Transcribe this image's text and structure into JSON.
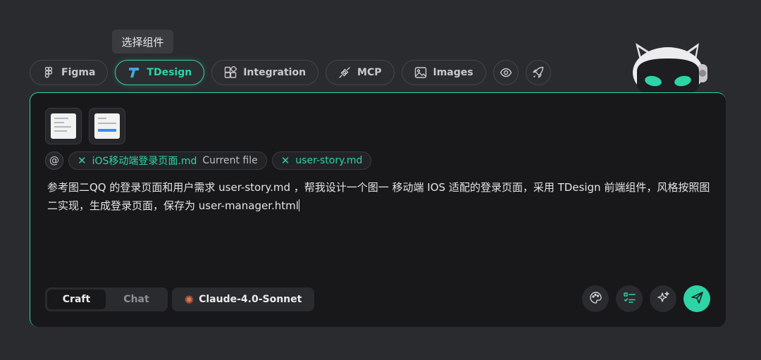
{
  "tooltip": "选择组件",
  "toolbar": {
    "figma": "Figma",
    "tdesign": "TDesign",
    "integration": "Integration",
    "mcp": "MCP",
    "images": "Images"
  },
  "attachments": {
    "at_symbol": "@",
    "files": [
      {
        "name": "iOS移动端登录页面.md",
        "tag": "Current file"
      },
      {
        "name": "user-story.md",
        "tag": ""
      }
    ],
    "remove_glyph": "✕"
  },
  "prompt": {
    "text": "参考图二QQ 的登录页面和用户需求 user-story.md ，帮我设计一个图一 移动端 IOS 适配的登录页面，采用 TDesign 前端组件，风格按照图二实现，生成登录页面，保存为 user-manager.html"
  },
  "footer": {
    "modes": [
      "Craft",
      "Chat"
    ],
    "active_mode": "Craft",
    "model": "Claude-4.0-Sonnet"
  },
  "colors": {
    "accent": "#2ed3a6",
    "panel_bg": "#18181b",
    "page_bg": "#2a2b2e",
    "model_spark": "#e5734a"
  },
  "icons": [
    "figma-icon",
    "tdesign-icon",
    "integration-icon",
    "mcp-icon",
    "images-icon",
    "eye-icon",
    "rocket-icon",
    "palette-icon",
    "checklist-icon",
    "sparkle-icon",
    "send-icon"
  ]
}
